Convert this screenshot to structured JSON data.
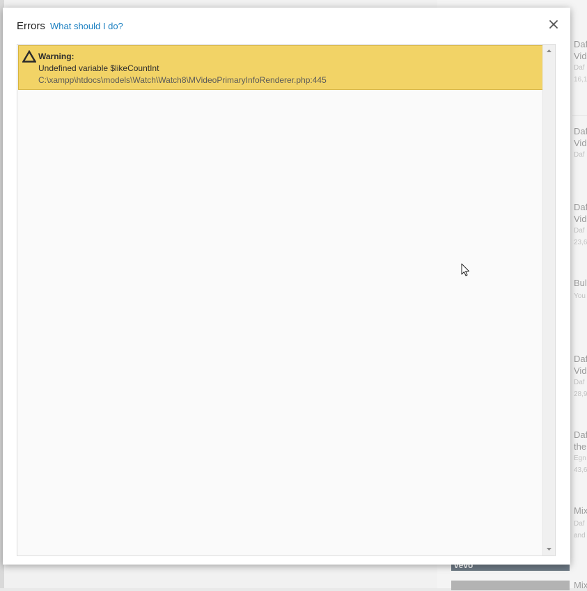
{
  "dialog": {
    "title": "Errors",
    "help_link": "What should I do?",
    "close_icon": "close-icon"
  },
  "errors": [
    {
      "type": "Warning:",
      "message": "Undefined variable $likeCountInt",
      "path": "C:\\xampp\\htdocs\\models\\Watch\\Watch8\\MVideoPrimaryInfoRenderer.php:445",
      "icon": "warning-triangle-icon"
    }
  ],
  "colors": {
    "warning_bg": "#f2d366",
    "warning_border": "#d8b53e",
    "link": "#1a7fc1"
  },
  "background_page": {
    "sidebar_items": [
      {
        "title": "Daf",
        "title2": "Vid",
        "sub": "Daf",
        "sub2": "16,1"
      },
      {
        "title": "Daf",
        "title2": "Vid",
        "sub": "Daf",
        "sub2": ""
      },
      {
        "title": "Daf",
        "title2": "Vid",
        "sub": "Daf",
        "sub2": "23,6"
      },
      {
        "title": "Bul",
        "title2": "",
        "sub": "You",
        "sub2": ""
      },
      {
        "title": "Daf",
        "title2": "Vid",
        "sub": "Daf",
        "sub2": "28,9"
      },
      {
        "title": "Daf",
        "title2": "the",
        "sub": "Egn",
        "sub2": "43,6"
      },
      {
        "title": "Mix",
        "title2": "",
        "sub": "Daf",
        "sub2": "and"
      },
      {
        "title": "Mix",
        "title2": "",
        "sub": "",
        "sub2": ""
      }
    ],
    "thumb_label": "vevo"
  }
}
